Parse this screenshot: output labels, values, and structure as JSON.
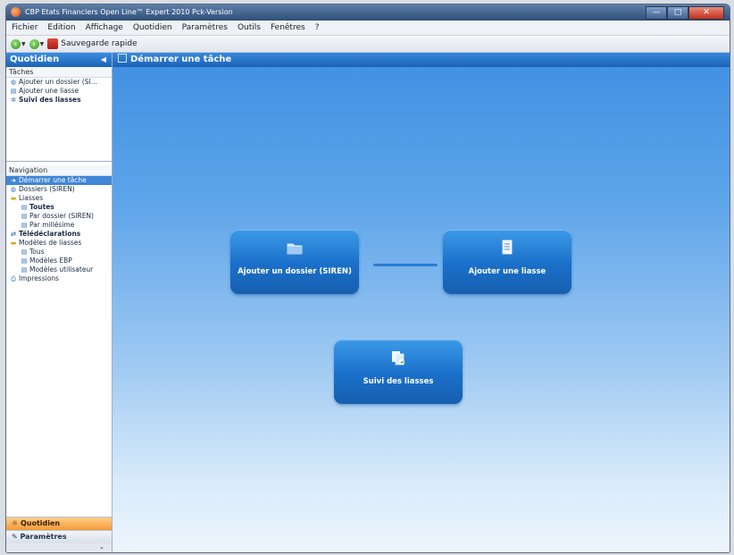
{
  "window": {
    "title": "CBP Etats Financiers Open Line™ Expert 2010 Pck-Version",
    "controls": {
      "minimize": "—",
      "maximize": "□",
      "close": "✕"
    }
  },
  "menu": [
    "Fichier",
    "Edition",
    "Affichage",
    "Quotidien",
    "Paramètres",
    "Outils",
    "Fenêtres",
    "?"
  ],
  "toolbar": {
    "quick_save_label": "Sauvegarde rapide"
  },
  "sidebar": {
    "header": "Quotidien",
    "tasks_label": "Tâches",
    "tasks": [
      {
        "label": "Ajouter un dossier (SI...",
        "icon": "globe-icon",
        "bold": false
      },
      {
        "label": "Ajouter une liasse",
        "icon": "document-icon",
        "bold": false
      },
      {
        "label": "Suivi des liasses",
        "icon": "gear-icon",
        "bold": true
      }
    ],
    "navigation_label": "Navigation",
    "navigation": [
      {
        "label": "Démarrer une tâche",
        "icon": "arrow-icon",
        "level": 1,
        "selected": true
      },
      {
        "label": "Dossiers (SIREN)",
        "icon": "globe-icon",
        "level": 1,
        "selected": false
      },
      {
        "label": "Liasses",
        "icon": "folder-icon",
        "level": 1,
        "selected": false
      },
      {
        "label": "Toutes",
        "icon": "document-icon",
        "level": 2,
        "selected": false,
        "bold": true
      },
      {
        "label": "Par dossier (SIREN)",
        "icon": "document-icon",
        "level": 2,
        "selected": false
      },
      {
        "label": "Par millésime",
        "icon": "document-icon",
        "level": 2,
        "selected": false
      },
      {
        "label": "Télédéclarations",
        "icon": "transfer-icon",
        "level": 1,
        "selected": false
      },
      {
        "label": "Modèles de liasses",
        "icon": "folder-icon",
        "level": 1,
        "selected": false
      },
      {
        "label": "Tous",
        "icon": "document-icon",
        "level": 2,
        "selected": false
      },
      {
        "label": "Modèles EBP",
        "icon": "document-icon",
        "level": 2,
        "selected": false
      },
      {
        "label": "Modèles utilisateur",
        "icon": "document-icon",
        "level": 2,
        "selected": false
      },
      {
        "label": "Impressions",
        "icon": "printer-icon",
        "level": 1,
        "selected": false
      }
    ],
    "bottom_tabs": [
      {
        "label": "Quotidien",
        "active": true
      },
      {
        "label": "Paramètres",
        "active": false
      }
    ],
    "footer_glyph": "⌄"
  },
  "main": {
    "header": "Démarrer une tâche",
    "tasks": {
      "add_folder": "Ajouter un dossier (SIREN)",
      "add_liasse": "Ajouter une liasse",
      "suivi": "Suivi des liasses"
    }
  },
  "colors": {
    "accent": "#1f6fc8",
    "header_blue": "#2477cc",
    "selected_row": "#3f86d6",
    "active_tab": "#f59a36"
  }
}
